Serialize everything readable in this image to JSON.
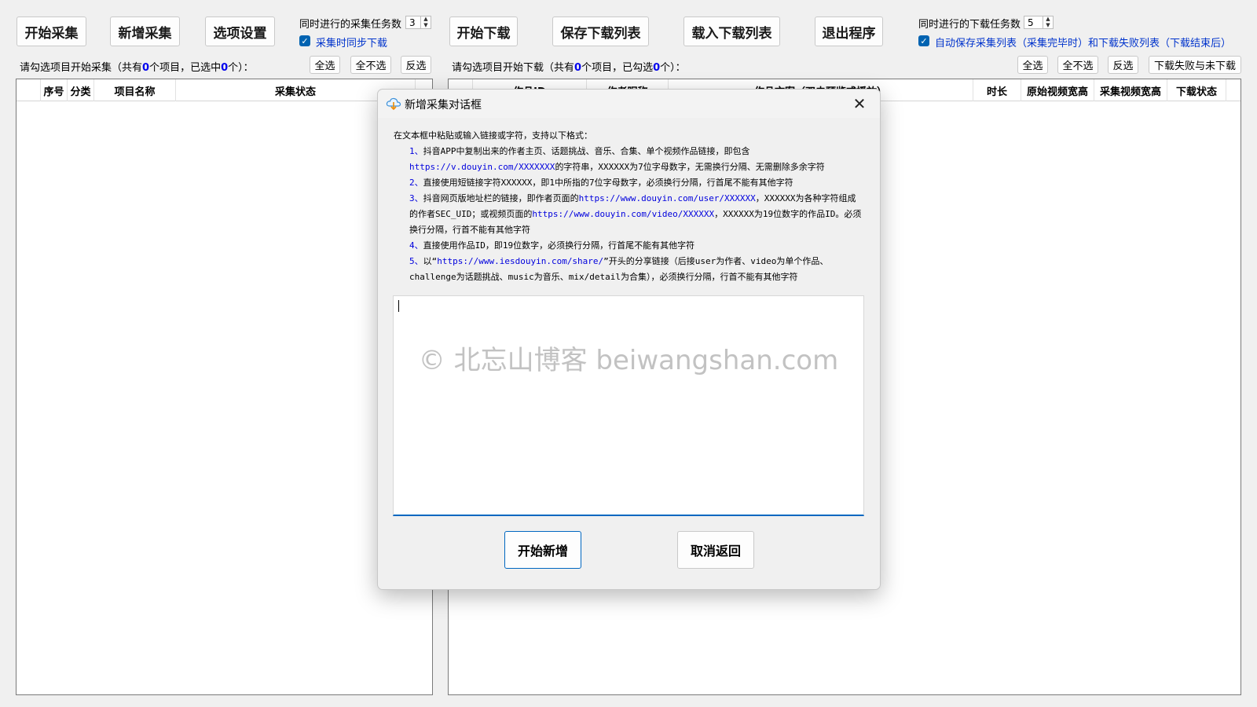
{
  "toolbar_left": {
    "start_collect": "开始采集",
    "add_collect": "新增采集",
    "options": "选项设置",
    "concurrent_collect_label": "同时进行的采集任务数",
    "concurrent_collect_value": "3",
    "sync_download_label": "采集时同步下载",
    "sync_download_checked": true
  },
  "toolbar_right": {
    "start_download": "开始下载",
    "save_list": "保存下载列表",
    "load_list": "载入下载列表",
    "exit": "退出程序",
    "concurrent_download_label": "同时进行的下载任务数",
    "concurrent_download_value": "5",
    "autosave_label": "自动保存采集列表（采集完毕时）和下载失败列表（下载结束后）",
    "autosave_checked": true
  },
  "collect_panel": {
    "status_prefix": "请勾选项目开始采集（共有",
    "total": "0",
    "status_mid": "个项目，已选中",
    "selected": "0",
    "status_suffix": "个）：",
    "select_all": "全选",
    "select_none": "全不选",
    "invert": "反选",
    "columns": [
      "序号",
      "分类",
      "项目名称",
      "采集状态"
    ]
  },
  "download_panel": {
    "status_prefix": "请勾选项目开始下载（共有",
    "total": "0",
    "status_mid": "个项目，已勾选",
    "selected": "0",
    "status_suffix": "个）：",
    "select_all": "全选",
    "select_none": "全不选",
    "invert": "反选",
    "fail_download": "下载失败与未下载",
    "columns": [
      "作品ID",
      "作者昵称",
      "作品文案（双击预览或播放）",
      "时长",
      "原始视频宽高",
      "采集视频宽高",
      "下载状态"
    ]
  },
  "dialog": {
    "title": "新增采集对话框",
    "intro": "在文本框中粘贴或输入链接或字符，支持以下格式：",
    "items": [
      {
        "num": "1、",
        "t1": "抖音APP中复制出来的作者主页、话题挑战、音乐、合集、单个视频作品链接，即包含",
        "l1": "https://v.douyin.com/XXXXXXX",
        "t2": "的字符串，XXXXXX为7位字母数字，无需换行分隔、无需删除多余字符"
      },
      {
        "num": "2、",
        "t1": "直接使用短链接字符XXXXXX，即1中所指的7位字母数字，必须换行分隔，行首尾不能有其他字符"
      },
      {
        "num": "3、",
        "t1": "抖音网页版地址栏的链接，即作者页面的",
        "l1": "https://www.douyin.com/user/XXXXXX",
        "t2": "，XXXXXX为各种字符组成的作者SEC_UID；或视频页面的",
        "l2": "https://www.douyin.com/video/XXXXXX",
        "t3": "，XXXXXX为19位数字的作品ID。必须换行分隔，行首不能有其他字符"
      },
      {
        "num": "4、",
        "t1": "直接使用作品ID，即19位数字，必须换行分隔，行首尾不能有其他字符"
      },
      {
        "num": "5、",
        "t1": "以“",
        "l1": "https://www.iesdouyin.com/share/",
        "t2": "”开头的分享链接（后接user为作者、video为单个作品、challenge为话题挑战、music为音乐、mix/detail为合集），必须换行分隔，行首不能有其他字符"
      }
    ],
    "input_value": "",
    "watermark": "© 北忘山博客 beiwangshan.com",
    "start_add": "开始新增",
    "cancel": "取消返回",
    "close_icon": "close-icon",
    "app_icon": "cloud-download-icon"
  },
  "colors": {
    "accent": "#0067c0",
    "checkbox": "#0063b1",
    "link": "#0000dd",
    "highlight_num": "#0000ee"
  }
}
